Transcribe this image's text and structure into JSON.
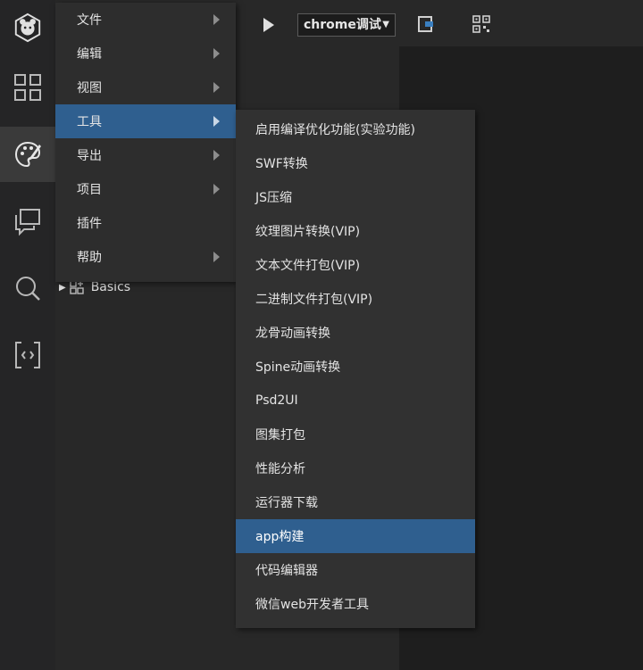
{
  "toolbar": {
    "run_target": "chrome调试"
  },
  "tree": {
    "item_label": "Basics"
  },
  "main_menu": {
    "items": [
      {
        "label": "文件",
        "has_submenu": true
      },
      {
        "label": "编辑",
        "has_submenu": true
      },
      {
        "label": "视图",
        "has_submenu": true
      },
      {
        "label": "工具",
        "has_submenu": true,
        "highlighted": true
      },
      {
        "label": "导出",
        "has_submenu": true
      },
      {
        "label": "项目",
        "has_submenu": true
      },
      {
        "label": "插件",
        "has_submenu": false
      },
      {
        "label": "帮助",
        "has_submenu": true
      }
    ]
  },
  "tools_submenu": {
    "items": [
      {
        "label": "启用编译优化功能(实验功能)"
      },
      {
        "label": "SWF转换"
      },
      {
        "label": "JS压缩"
      },
      {
        "label": "纹理图片转换(VIP)"
      },
      {
        "label": "文本文件打包(VIP)"
      },
      {
        "label": "二进制文件打包(VIP)"
      },
      {
        "label": "龙骨动画转换"
      },
      {
        "label": "Spine动画转换"
      },
      {
        "label": "Psd2UI"
      },
      {
        "label": "图集打包"
      },
      {
        "label": "性能分析"
      },
      {
        "label": "运行器下载"
      },
      {
        "label": "app构建",
        "highlighted": true
      },
      {
        "label": "代码编辑器"
      },
      {
        "label": "微信web开发者工具"
      }
    ]
  },
  "activity_bar": {
    "icons": [
      "logo-icon",
      "grid-icon",
      "palette-icon",
      "chat-icon",
      "search-icon",
      "code-icon"
    ]
  },
  "colors": {
    "highlight": "#2f5f8f",
    "menu_bg": "#2d2d2d",
    "bg": "#2b2b2b"
  }
}
